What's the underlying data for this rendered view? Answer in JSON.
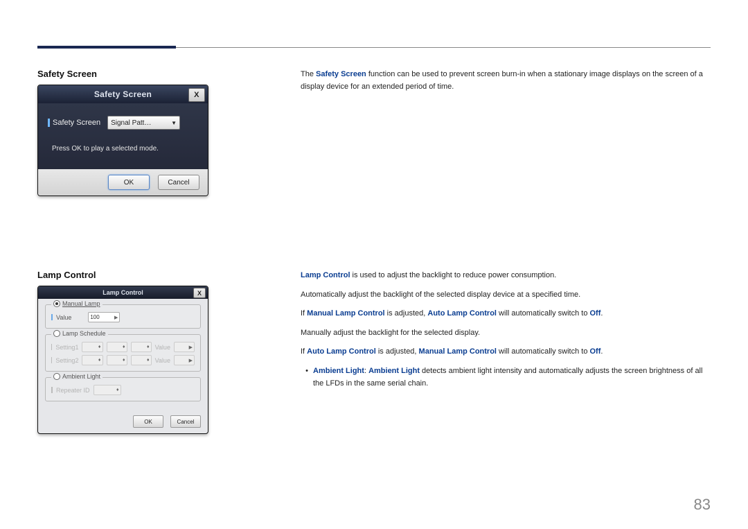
{
  "page_number": "83",
  "section1": {
    "title": "Safety Screen",
    "dialog": {
      "title": "Safety Screen",
      "close": "X",
      "field_label": "Safety Screen",
      "field_value": "Signal Patt…",
      "message": "Press OK to play a selected mode.",
      "ok": "OK",
      "cancel": "Cancel"
    },
    "desc_pre": "The ",
    "desc_bold": "Safety Screen",
    "desc_post": " function can be used to prevent screen burn-in when a stationary image displays on the screen of a display device for an extended period of time."
  },
  "section2": {
    "title": "Lamp Control",
    "dialog": {
      "title": "Lamp Control",
      "close": "X",
      "manual_lamp_legend": "Manual Lamp",
      "value_label": "Value",
      "value_val": "100",
      "lamp_schedule_legend": "Lamp Schedule",
      "setting1": "Setting1",
      "setting2": "Setting2",
      "schedule_value_label": "Value",
      "ambient_legend": "Ambient Light",
      "repeater_label": "Repeater ID",
      "ok": "OK",
      "cancel": "Cancel"
    },
    "line1_bold": "Lamp Control",
    "line1_rest": " is used to adjust the backlight to reduce power consumption.",
    "line2": "Automatically adjust the backlight of the selected display device at a specified time.",
    "line3_pre": "If ",
    "line3_b1": "Manual Lamp Control",
    "line3_mid": " is adjusted, ",
    "line3_b2": "Auto Lamp Control",
    "line3_post_a": " will automatically switch to ",
    "line3_off": "Off",
    "line3_dot": ".",
    "line4": "Manually adjust the backlight for the selected display.",
    "line5_pre": "If ",
    "line5_b1": "Auto Lamp Control",
    "line5_mid": " is adjusted, ",
    "line5_b2": "Manual Lamp Control",
    "line5_post_a": " will automatically switch to ",
    "line5_off": "Off",
    "line5_dot": ".",
    "bullet_b1": "Ambient Light",
    "bullet_colon": ": ",
    "bullet_b2": "Ambient Light",
    "bullet_rest": " detects ambient light intensity and automatically adjusts the screen brightness of all the LFDs in the same serial chain."
  }
}
